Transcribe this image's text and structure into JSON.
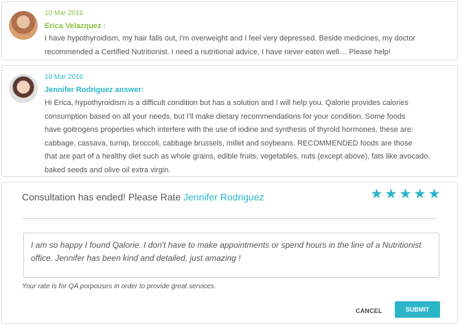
{
  "question": {
    "date": "10 Mar 2016",
    "author": "Erica Velazquez :",
    "lines": [
      "I have hypothyroidism, my hair falls out, I'm overweight and I feel very depressed. Beside medicines, my doctor",
      "recommended a Certified Nutritionist. I need a nutritional advice, I have never eaten well… Please help!"
    ]
  },
  "answer": {
    "date": "10 Mar 2016",
    "author": "Jennifer Rodriguez answer:",
    "lines": [
      "Hi Erica, hypothyroidism is a difficult condition but has a solution and I will help you. Qalorie provides calories",
      "consumption based on all your needs, but I'll make dietary recommendations for your condition. Some foods",
      "have goitrogens properties which interfere with the use of iodine and synthesis of thyrold hormones, these are:",
      "cabbage, cassava, turnip, broccoli, cabbage brussels, millet and soybeans. RECOMMENDED foods are those",
      "that are part of a healthy diet such as whole grains, edible fruits, vegetables, nuts (except above), fats like avocado,",
      "baked seeds and olive oil extra virgin."
    ]
  },
  "rating": {
    "title_prefix": "Consultation has ended! Please Rate",
    "nutritionist_name": "Jennifer Rodriguez",
    "stars_filled": 5,
    "stars_total": 5,
    "accent_color": "#2bb5c8",
    "star_icon": "star-icon",
    "review_text": "I am so happy I found Qalorie. I don't have to make appointments or spend hours in the line of a Nutritionist office. Jennifer has been kind and detailed, just amazing !",
    "note": "Your rate is for QA porpouses in order to provide great services.",
    "cancel_label": "CANCEL",
    "submit_label": "SUBMIT"
  }
}
